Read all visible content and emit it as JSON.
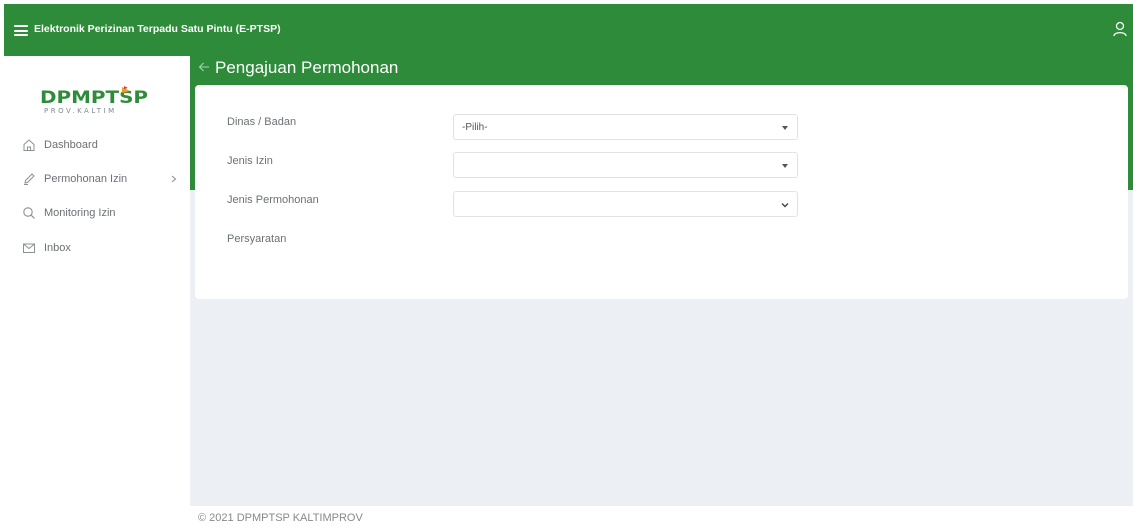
{
  "header": {
    "app_title": "Elektronik Perizinan Terpadu Satu Pintu (E-PTSP)",
    "menu_icon": "hamburger-menu-icon",
    "user_icon": "user-icon",
    "bar_color": "#2e8b3a"
  },
  "sidebar": {
    "logo_text": "DPMPTSP",
    "logo_sub": "PROV.KALTIM",
    "items": [
      {
        "label": "Dashboard",
        "icon": "home-icon"
      },
      {
        "label": "Permohonan Izin",
        "icon": "pencil-icon",
        "has_submenu": true
      },
      {
        "label": "Monitoring Izin",
        "icon": "search-icon"
      },
      {
        "label": "Inbox",
        "icon": "mail-icon"
      }
    ]
  },
  "page": {
    "title": "Pengajuan Permohonan",
    "back_icon": "arrow-left-icon"
  },
  "form": {
    "dinas_label": "Dinas / Badan",
    "dinas_value": "-Pilih-",
    "jenis_izin_label": "Jenis Izin",
    "jenis_izin_value": "",
    "jenis_permohonan_label": "Jenis Permohonan",
    "jenis_permohonan_value": "",
    "persyaratan_label": "Persyaratan"
  },
  "footer": {
    "copyright": "© 2021 DPMPTSP KALTIMPROV"
  }
}
